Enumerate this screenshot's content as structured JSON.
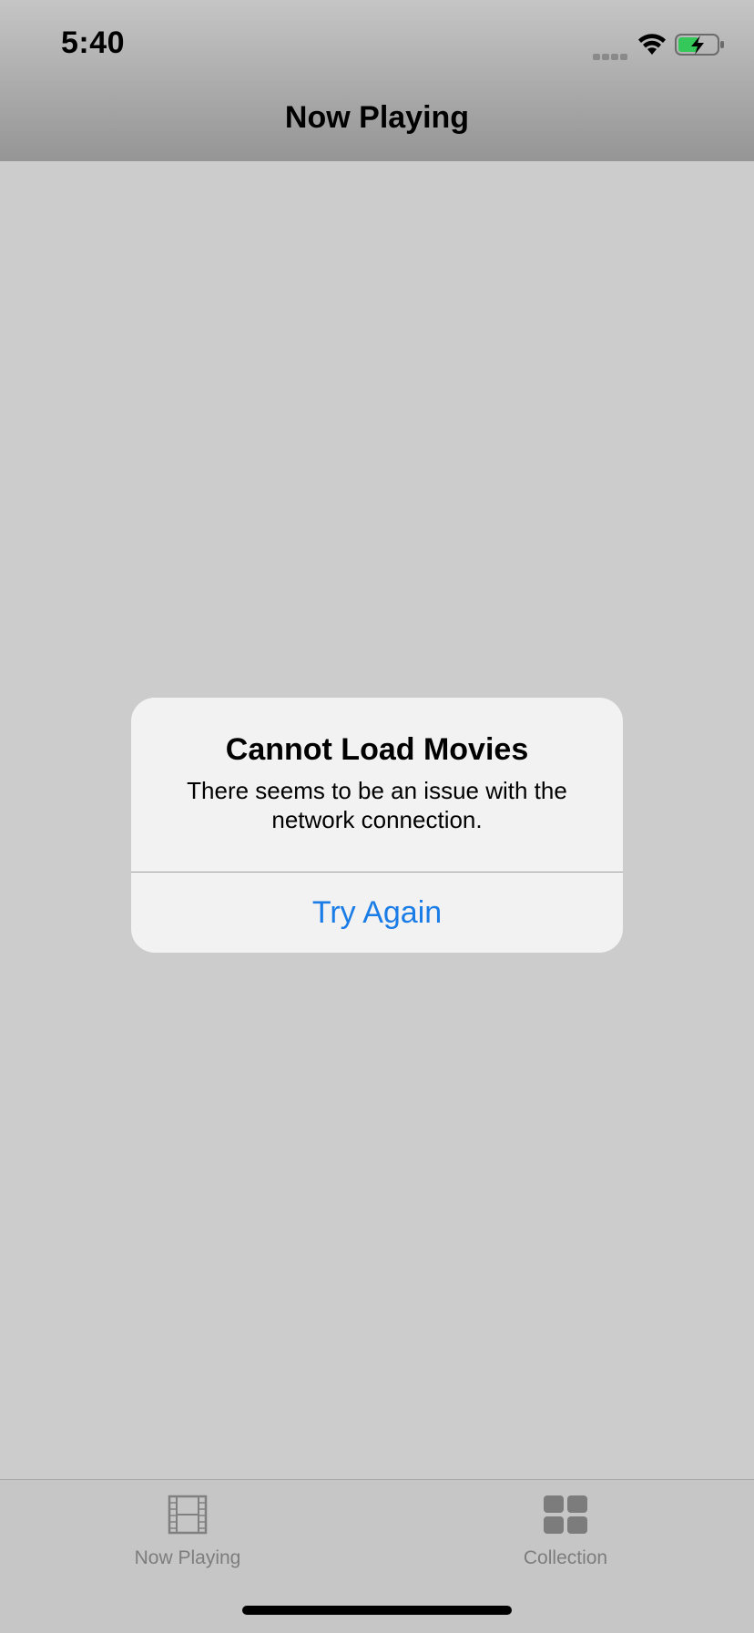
{
  "status_bar": {
    "time": "5:40",
    "signal_icon": "cellular-signal-icon",
    "wifi_icon": "wifi-icon",
    "battery_icon": "battery-charging-icon",
    "battery_color": "#34c759"
  },
  "navigation": {
    "title": "Now Playing"
  },
  "alert": {
    "title": "Cannot Load Movies",
    "message": "There seems to be an issue with the network connection.",
    "button_label": "Try Again",
    "button_color": "#1a7ce6"
  },
  "tab_bar": {
    "tabs": [
      {
        "label": "Now Playing",
        "icon": "film-strip-icon"
      },
      {
        "label": "Collection",
        "icon": "grid-icon"
      }
    ]
  }
}
